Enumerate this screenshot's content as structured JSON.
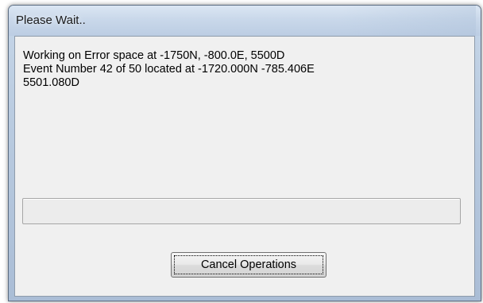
{
  "window": {
    "title": "Please Wait.."
  },
  "message": {
    "line1": "Working on Error space at -1750N, -800.0E, 5500D",
    "line2": "Event Number 42 of 50 located at -1720.000N -785.406E",
    "line3": "5501.080D"
  },
  "progress": {
    "fill_fraction": 0
  },
  "buttons": {
    "cancel_label": "Cancel Operations"
  }
}
